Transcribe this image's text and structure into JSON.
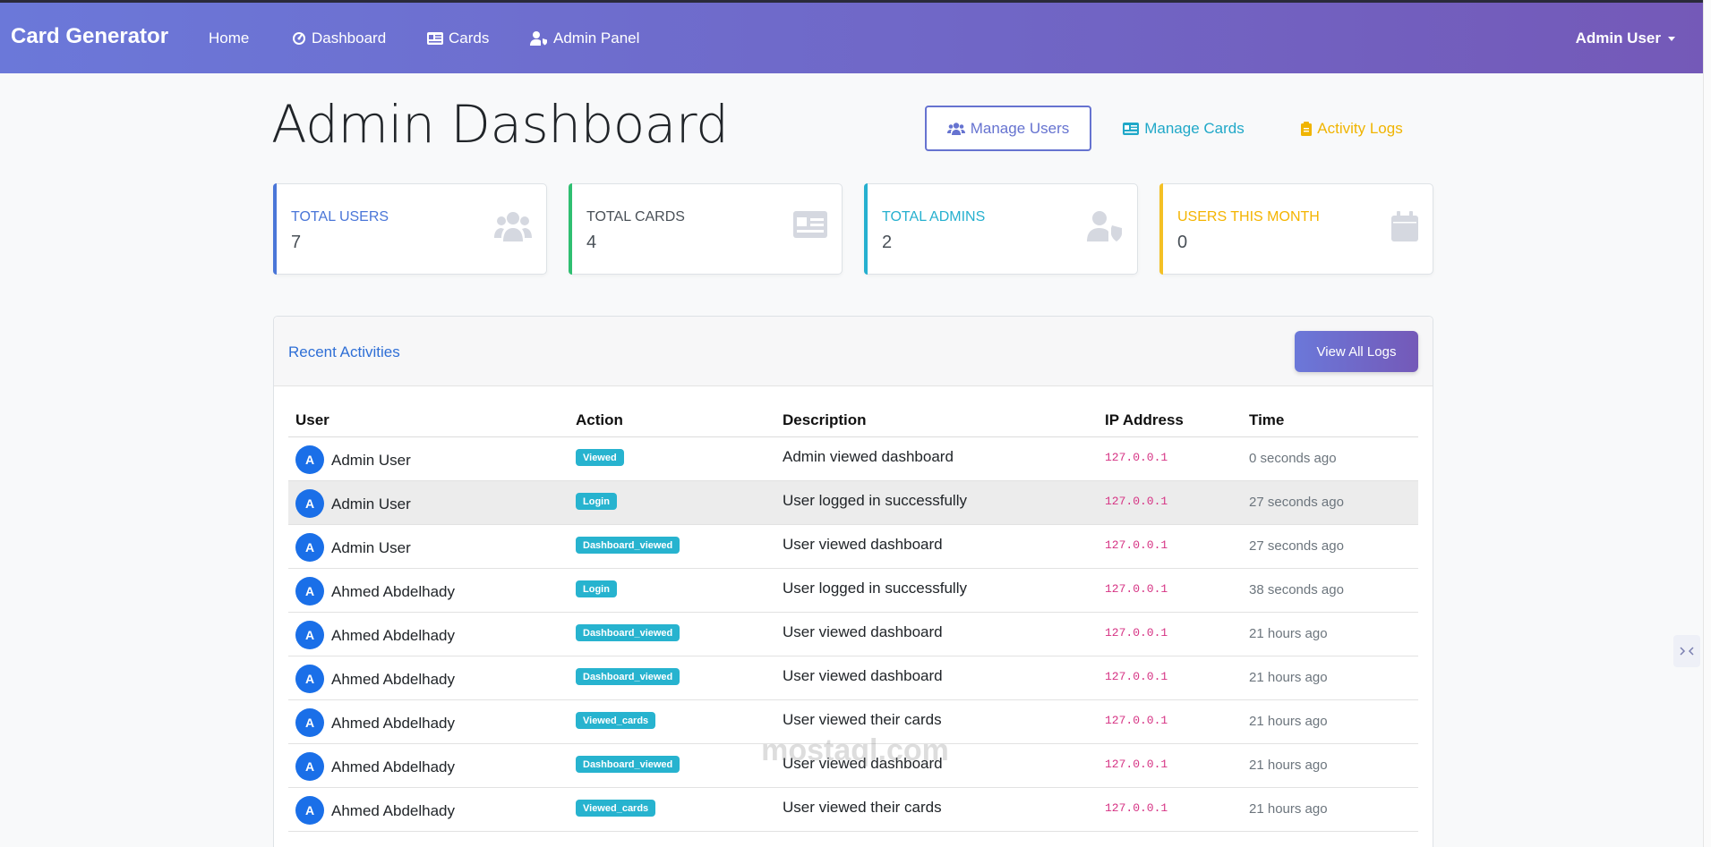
{
  "navbar": {
    "brand": "Card Generator",
    "links": [
      {
        "label": "Home",
        "icon": "none"
      },
      {
        "label": "Dashboard",
        "icon": "dashboard-icon"
      },
      {
        "label": "Cards",
        "icon": "id-card-icon"
      },
      {
        "label": "Admin Panel",
        "icon": "user-shield-icon"
      }
    ],
    "user": "Admin User"
  },
  "header": {
    "title": "Admin Dashboard",
    "buttons": {
      "manage_users": "Manage Users",
      "manage_cards": "Manage Cards",
      "activity_logs": "Activity Logs"
    }
  },
  "stats": [
    {
      "label": "Total Users",
      "value": "7",
      "color": "#4a76d8",
      "icon": "users-icon"
    },
    {
      "label": "Total Cards",
      "value": "4",
      "color": "#2fbf71",
      "icon": "id-card-icon"
    },
    {
      "label": "Total Admins",
      "value": "2",
      "color": "#26b0cf",
      "icon": "user-shield-icon"
    },
    {
      "label": "Users This Month",
      "value": "0",
      "color": "#f4c025",
      "icon": "calendar-icon"
    }
  ],
  "activities": {
    "title": "Recent Activities",
    "view_all": "View All Logs",
    "columns": [
      "User",
      "Action",
      "Description",
      "IP Address",
      "Time"
    ],
    "rows": [
      {
        "initial": "A",
        "user": "Admin User",
        "action": "Viewed",
        "desc": "Admin viewed dashboard",
        "ip": "127.0.0.1",
        "time": "0 seconds ago"
      },
      {
        "initial": "A",
        "user": "Admin User",
        "action": "Login",
        "desc": "User logged in successfully",
        "ip": "127.0.0.1",
        "time": "27 seconds ago"
      },
      {
        "initial": "A",
        "user": "Admin User",
        "action": "Dashboard_viewed",
        "desc": "User viewed dashboard",
        "ip": "127.0.0.1",
        "time": "27 seconds ago"
      },
      {
        "initial": "A",
        "user": "Ahmed Abdelhady",
        "action": "Login",
        "desc": "User logged in successfully",
        "ip": "127.0.0.1",
        "time": "38 seconds ago"
      },
      {
        "initial": "A",
        "user": "Ahmed Abdelhady",
        "action": "Dashboard_viewed",
        "desc": "User viewed dashboard",
        "ip": "127.0.0.1",
        "time": "21 hours ago"
      },
      {
        "initial": "A",
        "user": "Ahmed Abdelhady",
        "action": "Dashboard_viewed",
        "desc": "User viewed dashboard",
        "ip": "127.0.0.1",
        "time": "21 hours ago"
      },
      {
        "initial": "A",
        "user": "Ahmed Abdelhady",
        "action": "Viewed_cards",
        "desc": "User viewed their cards",
        "ip": "127.0.0.1",
        "time": "21 hours ago"
      },
      {
        "initial": "A",
        "user": "Ahmed Abdelhady",
        "action": "Dashboard_viewed",
        "desc": "User viewed dashboard",
        "ip": "127.0.0.1",
        "time": "21 hours ago"
      },
      {
        "initial": "A",
        "user": "Ahmed Abdelhady",
        "action": "Viewed_cards",
        "desc": "User viewed their cards",
        "ip": "127.0.0.1",
        "time": "21 hours ago"
      }
    ]
  },
  "watermark": "mostaql.com"
}
